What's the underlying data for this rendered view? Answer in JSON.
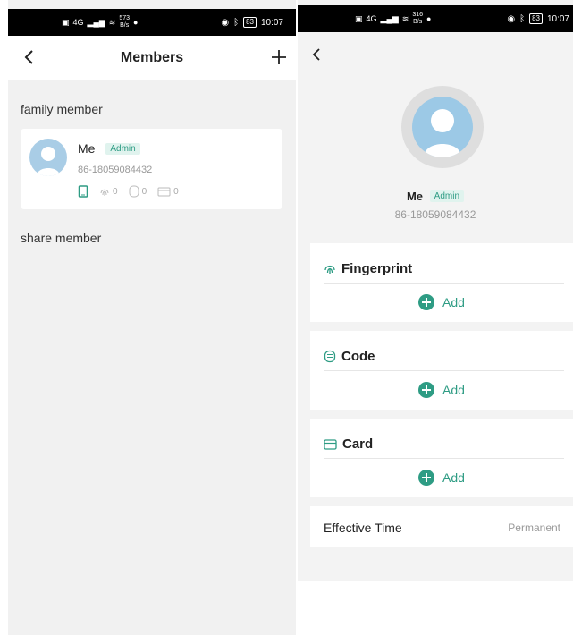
{
  "left_screen": {
    "status_bar": {
      "network": "4G",
      "speed_value": "573",
      "speed_unit": "B/s",
      "battery": "83",
      "time": "10:07"
    },
    "nav": {
      "title": "Members"
    },
    "sections": {
      "family_label": "family member",
      "share_label": "share member"
    },
    "member": {
      "name": "Me",
      "badge": "Admin",
      "phone": "86-18059084432",
      "fingerprint_count": "0",
      "code_count": "0",
      "card_count": "0"
    }
  },
  "right_screen": {
    "status_bar": {
      "network": "4G",
      "speed_value": "316",
      "speed_unit": "B/s",
      "battery": "83",
      "time": "10:07"
    },
    "profile": {
      "name": "Me",
      "badge": "Admin",
      "phone": "86-18059084432"
    },
    "cards": [
      {
        "title": "Fingerprint",
        "icon": "fingerprint-icon",
        "add_label": "Add"
      },
      {
        "title": "Code",
        "icon": "code-icon",
        "add_label": "Add"
      },
      {
        "title": "Card",
        "icon": "card-icon",
        "add_label": "Add"
      }
    ],
    "effective_time": {
      "label": "Effective Time",
      "value": "Permanent"
    }
  },
  "colors": {
    "accent": "#2e9c84",
    "avatar": "#a9cde6",
    "background": "#f1f1f1"
  }
}
